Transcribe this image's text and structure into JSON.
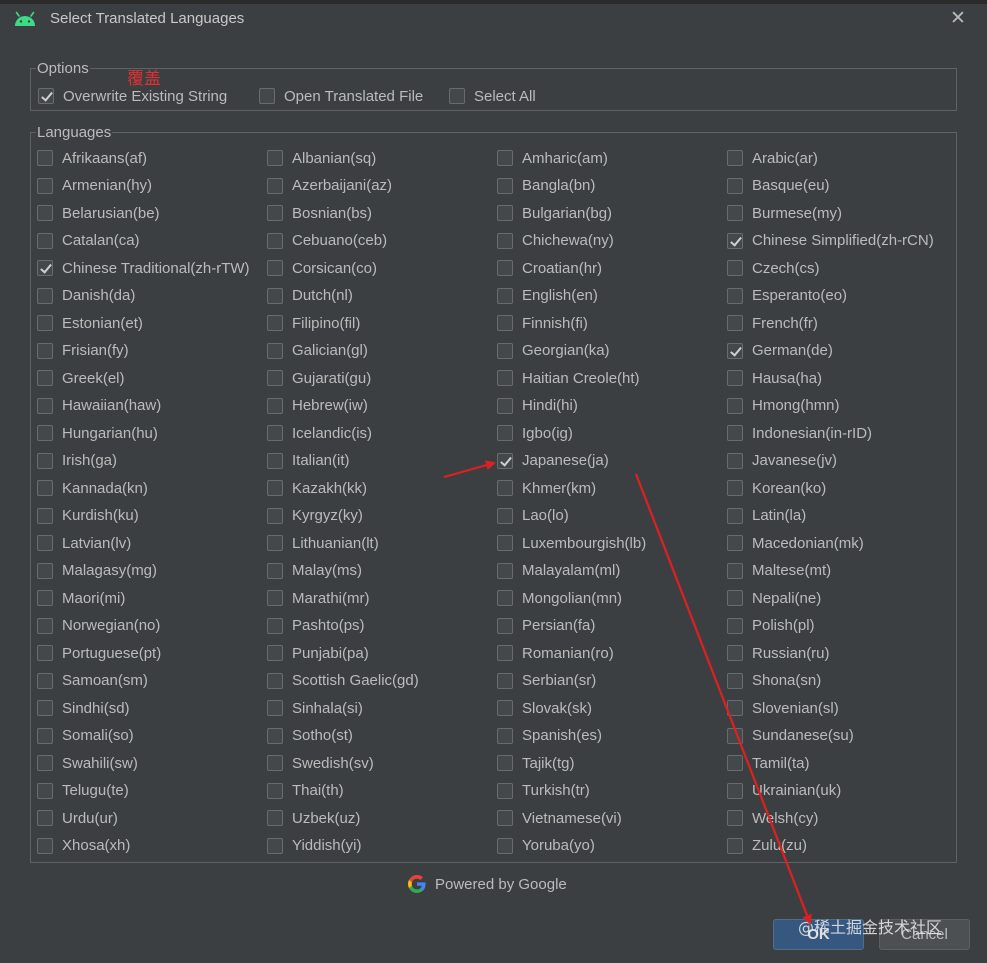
{
  "window": {
    "title": "Select Translated Languages",
    "close_glyph": "✕"
  },
  "options": {
    "legend": "Options",
    "items": [
      {
        "label": "Overwrite Existing String",
        "checked": true
      },
      {
        "label": "Open Translated File",
        "checked": false
      },
      {
        "label": "Select All",
        "checked": false
      }
    ]
  },
  "annotation": {
    "text": "覆盖",
    "color": "#e03030"
  },
  "languages": {
    "legend": "Languages",
    "items": [
      {
        "label": "Afrikaans(af)",
        "checked": false
      },
      {
        "label": "Albanian(sq)",
        "checked": false
      },
      {
        "label": "Amharic(am)",
        "checked": false
      },
      {
        "label": "Arabic(ar)",
        "checked": false
      },
      {
        "label": "Armenian(hy)",
        "checked": false
      },
      {
        "label": "Azerbaijani(az)",
        "checked": false
      },
      {
        "label": "Bangla(bn)",
        "checked": false
      },
      {
        "label": "Basque(eu)",
        "checked": false
      },
      {
        "label": "Belarusian(be)",
        "checked": false
      },
      {
        "label": "Bosnian(bs)",
        "checked": false
      },
      {
        "label": "Bulgarian(bg)",
        "checked": false
      },
      {
        "label": "Burmese(my)",
        "checked": false
      },
      {
        "label": "Catalan(ca)",
        "checked": false
      },
      {
        "label": "Cebuano(ceb)",
        "checked": false
      },
      {
        "label": "Chichewa(ny)",
        "checked": false
      },
      {
        "label": "Chinese Simplified(zh-rCN)",
        "checked": true
      },
      {
        "label": "Chinese Traditional(zh-rTW)",
        "checked": true
      },
      {
        "label": "Corsican(co)",
        "checked": false
      },
      {
        "label": "Croatian(hr)",
        "checked": false
      },
      {
        "label": "Czech(cs)",
        "checked": false
      },
      {
        "label": "Danish(da)",
        "checked": false
      },
      {
        "label": "Dutch(nl)",
        "checked": false
      },
      {
        "label": "English(en)",
        "checked": false
      },
      {
        "label": "Esperanto(eo)",
        "checked": false
      },
      {
        "label": "Estonian(et)",
        "checked": false
      },
      {
        "label": "Filipino(fil)",
        "checked": false
      },
      {
        "label": "Finnish(fi)",
        "checked": false
      },
      {
        "label": "French(fr)",
        "checked": false
      },
      {
        "label": "Frisian(fy)",
        "checked": false
      },
      {
        "label": "Galician(gl)",
        "checked": false
      },
      {
        "label": "Georgian(ka)",
        "checked": false
      },
      {
        "label": "German(de)",
        "checked": true
      },
      {
        "label": "Greek(el)",
        "checked": false
      },
      {
        "label": "Gujarati(gu)",
        "checked": false
      },
      {
        "label": "Haitian Creole(ht)",
        "checked": false
      },
      {
        "label": "Hausa(ha)",
        "checked": false
      },
      {
        "label": "Hawaiian(haw)",
        "checked": false
      },
      {
        "label": "Hebrew(iw)",
        "checked": false
      },
      {
        "label": "Hindi(hi)",
        "checked": false
      },
      {
        "label": "Hmong(hmn)",
        "checked": false
      },
      {
        "label": "Hungarian(hu)",
        "checked": false
      },
      {
        "label": "Icelandic(is)",
        "checked": false
      },
      {
        "label": "Igbo(ig)",
        "checked": false
      },
      {
        "label": "Indonesian(in-rID)",
        "checked": false
      },
      {
        "label": "Irish(ga)",
        "checked": false
      },
      {
        "label": "Italian(it)",
        "checked": false
      },
      {
        "label": "Japanese(ja)",
        "checked": true
      },
      {
        "label": "Javanese(jv)",
        "checked": false
      },
      {
        "label": "Kannada(kn)",
        "checked": false
      },
      {
        "label": "Kazakh(kk)",
        "checked": false
      },
      {
        "label": "Khmer(km)",
        "checked": false
      },
      {
        "label": "Korean(ko)",
        "checked": false
      },
      {
        "label": "Kurdish(ku)",
        "checked": false
      },
      {
        "label": "Kyrgyz(ky)",
        "checked": false
      },
      {
        "label": "Lao(lo)",
        "checked": false
      },
      {
        "label": "Latin(la)",
        "checked": false
      },
      {
        "label": "Latvian(lv)",
        "checked": false
      },
      {
        "label": "Lithuanian(lt)",
        "checked": false
      },
      {
        "label": "Luxembourgish(lb)",
        "checked": false
      },
      {
        "label": "Macedonian(mk)",
        "checked": false
      },
      {
        "label": "Malagasy(mg)",
        "checked": false
      },
      {
        "label": "Malay(ms)",
        "checked": false
      },
      {
        "label": "Malayalam(ml)",
        "checked": false
      },
      {
        "label": "Maltese(mt)",
        "checked": false
      },
      {
        "label": "Maori(mi)",
        "checked": false
      },
      {
        "label": "Marathi(mr)",
        "checked": false
      },
      {
        "label": "Mongolian(mn)",
        "checked": false
      },
      {
        "label": "Nepali(ne)",
        "checked": false
      },
      {
        "label": "Norwegian(no)",
        "checked": false
      },
      {
        "label": "Pashto(ps)",
        "checked": false
      },
      {
        "label": "Persian(fa)",
        "checked": false
      },
      {
        "label": "Polish(pl)",
        "checked": false
      },
      {
        "label": "Portuguese(pt)",
        "checked": false
      },
      {
        "label": "Punjabi(pa)",
        "checked": false
      },
      {
        "label": "Romanian(ro)",
        "checked": false
      },
      {
        "label": "Russian(ru)",
        "checked": false
      },
      {
        "label": "Samoan(sm)",
        "checked": false
      },
      {
        "label": "Scottish Gaelic(gd)",
        "checked": false
      },
      {
        "label": "Serbian(sr)",
        "checked": false
      },
      {
        "label": "Shona(sn)",
        "checked": false
      },
      {
        "label": "Sindhi(sd)",
        "checked": false
      },
      {
        "label": "Sinhala(si)",
        "checked": false
      },
      {
        "label": "Slovak(sk)",
        "checked": false
      },
      {
        "label": "Slovenian(sl)",
        "checked": false
      },
      {
        "label": "Somali(so)",
        "checked": false
      },
      {
        "label": "Sotho(st)",
        "checked": false
      },
      {
        "label": "Spanish(es)",
        "checked": false
      },
      {
        "label": "Sundanese(su)",
        "checked": false
      },
      {
        "label": "Swahili(sw)",
        "checked": false
      },
      {
        "label": "Swedish(sv)",
        "checked": false
      },
      {
        "label": "Tajik(tg)",
        "checked": false
      },
      {
        "label": "Tamil(ta)",
        "checked": false
      },
      {
        "label": "Telugu(te)",
        "checked": false
      },
      {
        "label": "Thai(th)",
        "checked": false
      },
      {
        "label": "Turkish(tr)",
        "checked": false
      },
      {
        "label": "Ukrainian(uk)",
        "checked": false
      },
      {
        "label": "Urdu(ur)",
        "checked": false
      },
      {
        "label": "Uzbek(uz)",
        "checked": false
      },
      {
        "label": "Vietnamese(vi)",
        "checked": false
      },
      {
        "label": "Welsh(cy)",
        "checked": false
      },
      {
        "label": "Xhosa(xh)",
        "checked": false
      },
      {
        "label": "Yiddish(yi)",
        "checked": false
      },
      {
        "label": "Yoruba(yo)",
        "checked": false
      },
      {
        "label": "Zulu(zu)",
        "checked": false
      }
    ]
  },
  "footer": {
    "powered_by": "Powered by Google",
    "ok_label": "OK",
    "cancel_label": "Cancel"
  },
  "watermark": "@稀土掘金技术社区",
  "colors": {
    "background": "#3c3f41",
    "text": "#bbbbbb",
    "ok_button": "#365880",
    "arrow": "#e02020"
  },
  "icons": {
    "app": "android-icon",
    "brand": "google-g-icon",
    "close": "close-icon"
  }
}
